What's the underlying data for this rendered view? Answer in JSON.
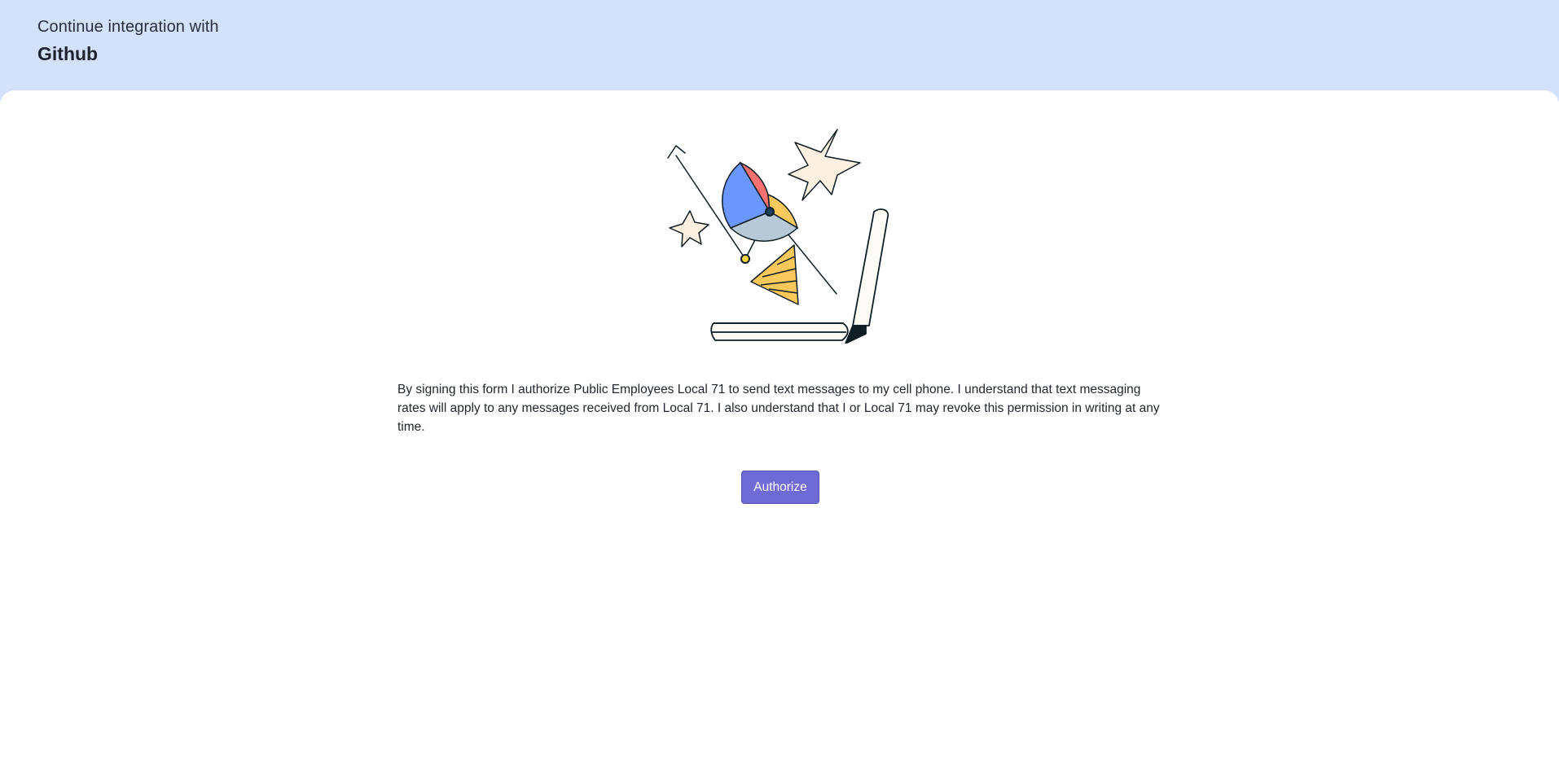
{
  "header": {
    "subtitle": "Continue integration with",
    "title": "Github"
  },
  "illustration": {
    "icon": "analytics-illustration-icon",
    "colors": {
      "red": "#f87171",
      "yellow": "#fbc85c",
      "blue": "#6b97fb",
      "gray_blue": "#b7c8d6",
      "cream": "#fdf0e0",
      "outline": "#0f1d24"
    }
  },
  "consent": {
    "text": "By signing this form I authorize Public Employees Local 71 to send text messages to my cell phone. I understand that text messaging rates will apply to any messages received from Local 71. I also understand that I or Local 71 may revoke this permission in writing at any time."
  },
  "actions": {
    "authorize_label": "Authorize"
  },
  "theme": {
    "header_background": "#d4e1fd",
    "button_background": "#6e6ad6"
  }
}
